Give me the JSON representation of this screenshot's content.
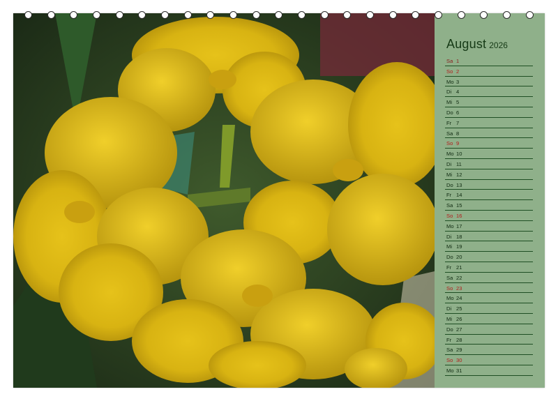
{
  "calendar": {
    "month": "August",
    "year": "2026",
    "days": [
      {
        "wd": "Sa",
        "n": "1",
        "type": "sat"
      },
      {
        "wd": "So",
        "n": "2",
        "type": "sun"
      },
      {
        "wd": "Mo",
        "n": "3",
        "type": ""
      },
      {
        "wd": "Di",
        "n": "4",
        "type": ""
      },
      {
        "wd": "Mi",
        "n": "5",
        "type": ""
      },
      {
        "wd": "Do",
        "n": "6",
        "type": ""
      },
      {
        "wd": "Fr",
        "n": "7",
        "type": ""
      },
      {
        "wd": "Sa",
        "n": "8",
        "type": ""
      },
      {
        "wd": "So",
        "n": "9",
        "type": "sun"
      },
      {
        "wd": "Mo",
        "n": "10",
        "type": ""
      },
      {
        "wd": "Di",
        "n": "11",
        "type": ""
      },
      {
        "wd": "Mi",
        "n": "12",
        "type": ""
      },
      {
        "wd": "Do",
        "n": "13",
        "type": ""
      },
      {
        "wd": "Fr",
        "n": "14",
        "type": ""
      },
      {
        "wd": "Sa",
        "n": "15",
        "type": ""
      },
      {
        "wd": "So",
        "n": "16",
        "type": "sun"
      },
      {
        "wd": "Mo",
        "n": "17",
        "type": ""
      },
      {
        "wd": "Di",
        "n": "18",
        "type": ""
      },
      {
        "wd": "Mi",
        "n": "19",
        "type": ""
      },
      {
        "wd": "Do",
        "n": "20",
        "type": ""
      },
      {
        "wd": "Fr",
        "n": "21",
        "type": ""
      },
      {
        "wd": "Sa",
        "n": "22",
        "type": ""
      },
      {
        "wd": "So",
        "n": "23",
        "type": "sun"
      },
      {
        "wd": "Mo",
        "n": "24",
        "type": ""
      },
      {
        "wd": "Di",
        "n": "25",
        "type": ""
      },
      {
        "wd": "Mi",
        "n": "26",
        "type": ""
      },
      {
        "wd": "Do",
        "n": "27",
        "type": ""
      },
      {
        "wd": "Fr",
        "n": "28",
        "type": ""
      },
      {
        "wd": "Sa",
        "n": "29",
        "type": ""
      },
      {
        "wd": "So",
        "n": "30",
        "type": "sun"
      },
      {
        "wd": "Mo",
        "n": "31",
        "type": ""
      }
    ]
  },
  "colors": {
    "panel": "#8fb08a",
    "line": "#1e4e23",
    "sunday": "#b31c1c",
    "flower": "#e2c21c",
    "ring": "#ffffff"
  }
}
